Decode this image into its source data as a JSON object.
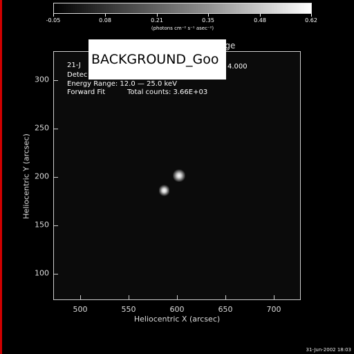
{
  "colorbar": {
    "labels": [
      "-0.05",
      "0.08",
      "0.21",
      "0.35",
      "0.48",
      "0.62"
    ],
    "units": "(photons cm⁻² s⁻¹ asec⁻²)"
  },
  "plot": {
    "title_fragment": "age",
    "line1": "21-J",
    "line1_right": "4.000",
    "line2": "Detec",
    "line3": "Energy Range: 12.0 — 25.0 keV",
    "line4_a": "Forward Fit",
    "line4_b": "Total counts: 3.66E+03",
    "overlay_box_text": "BACKGROUND_Goo"
  },
  "axes": {
    "xlabel": "Heliocentric X (arcsec)",
    "ylabel": "Heliocentric Y (arcsec)",
    "xticks": [
      "500",
      "550",
      "600",
      "650",
      "700"
    ],
    "yticks": [
      "100",
      "150",
      "200",
      "250",
      "300"
    ]
  },
  "footer": {
    "timestamp": "31-Jun-2002 18:03"
  }
}
